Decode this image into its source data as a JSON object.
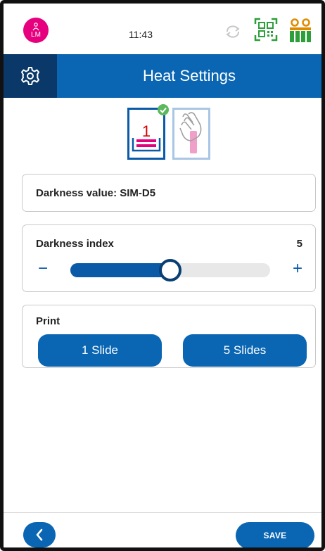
{
  "status_bar": {
    "avatar_initials": "LM",
    "time": "11:43",
    "icons": [
      "person-icon",
      "sync-icon",
      "qr-code-icon",
      "battery-icon"
    ]
  },
  "header": {
    "title": "Heat Settings",
    "icon": "gear-icon"
  },
  "modes": {
    "primary_number": "1",
    "primary_icon": "slide-print-icon",
    "secondary_icon": "hand-touch-icon",
    "selected": "slide-print"
  },
  "darkness_value": {
    "label": "Darkness value: SIM-D5"
  },
  "darkness_index": {
    "label": "Darkness index",
    "value": "5",
    "minus_label": "−",
    "plus_label": "+",
    "slider_fraction": 0.5
  },
  "print": {
    "label": "Print",
    "buttons": [
      "1 Slide",
      "5 Slides"
    ]
  },
  "footer": {
    "save_label": "SAVE",
    "back_icon": "chevron-left-icon"
  },
  "colors": {
    "primary": "#0a66b3",
    "dark_primary": "#0a3868",
    "avatar": "#e6007e",
    "accent_green": "#2e9e3a",
    "battery_orange": "#e08a00"
  }
}
